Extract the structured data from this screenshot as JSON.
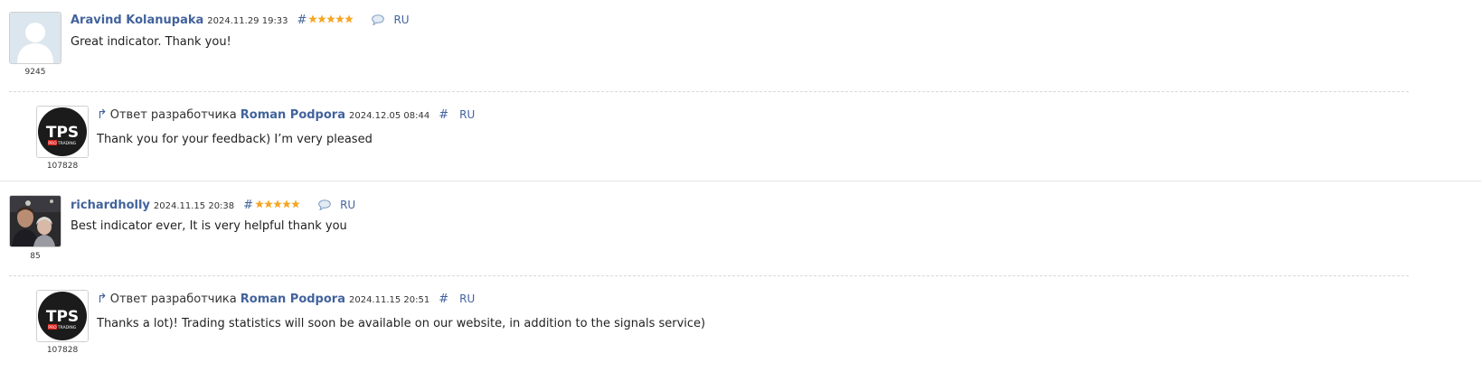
{
  "comments": [
    {
      "author": "Aravind Kolanupaka",
      "date": "2024.11.29 19:33",
      "hash": "#",
      "stars": 5,
      "lang": "RU",
      "text": "Great indicator. Thank you!",
      "rating": "9245",
      "avatar": "default-user-avatar"
    },
    {
      "reply_label": "Ответ разработчика",
      "author": "Roman Podpora",
      "date": "2024.12.05 08:44",
      "hash": "#",
      "lang": "RU",
      "text": "Thank you for your feedback) I’m very pleased",
      "rating": "107828",
      "avatar": "tps-logo-avatar",
      "logo_text": "TPS",
      "logo_sub_left": "PRO",
      "logo_sub_right": "TRADING"
    },
    {
      "author": "richardholly",
      "date": "2024.11.15 20:38",
      "hash": "#",
      "stars": 5,
      "lang": "RU",
      "text": "Best indicator ever, It is very helpful thank you",
      "rating": "85",
      "avatar": "photo-avatar"
    },
    {
      "reply_label": "Ответ разработчика",
      "author": "Roman Podpora",
      "date": "2024.11.15 20:51",
      "hash": "#",
      "lang": "RU",
      "text": "Thanks a lot)! Trading statistics will soon be available on our website, in addition to the signals service)",
      "rating": "107828",
      "avatar": "tps-logo-avatar",
      "logo_text": "TPS",
      "logo_sub_left": "PRO",
      "logo_sub_right": "TRADING"
    }
  ],
  "colors": {
    "link": "#42639c",
    "star": "#f5a623",
    "logo_bg": "#1b1b1b",
    "logo_red": "#d9231d"
  },
  "icons": {
    "star": "star-icon",
    "comment": "speech-bubble-icon",
    "reply": "reply-arrow-icon"
  }
}
